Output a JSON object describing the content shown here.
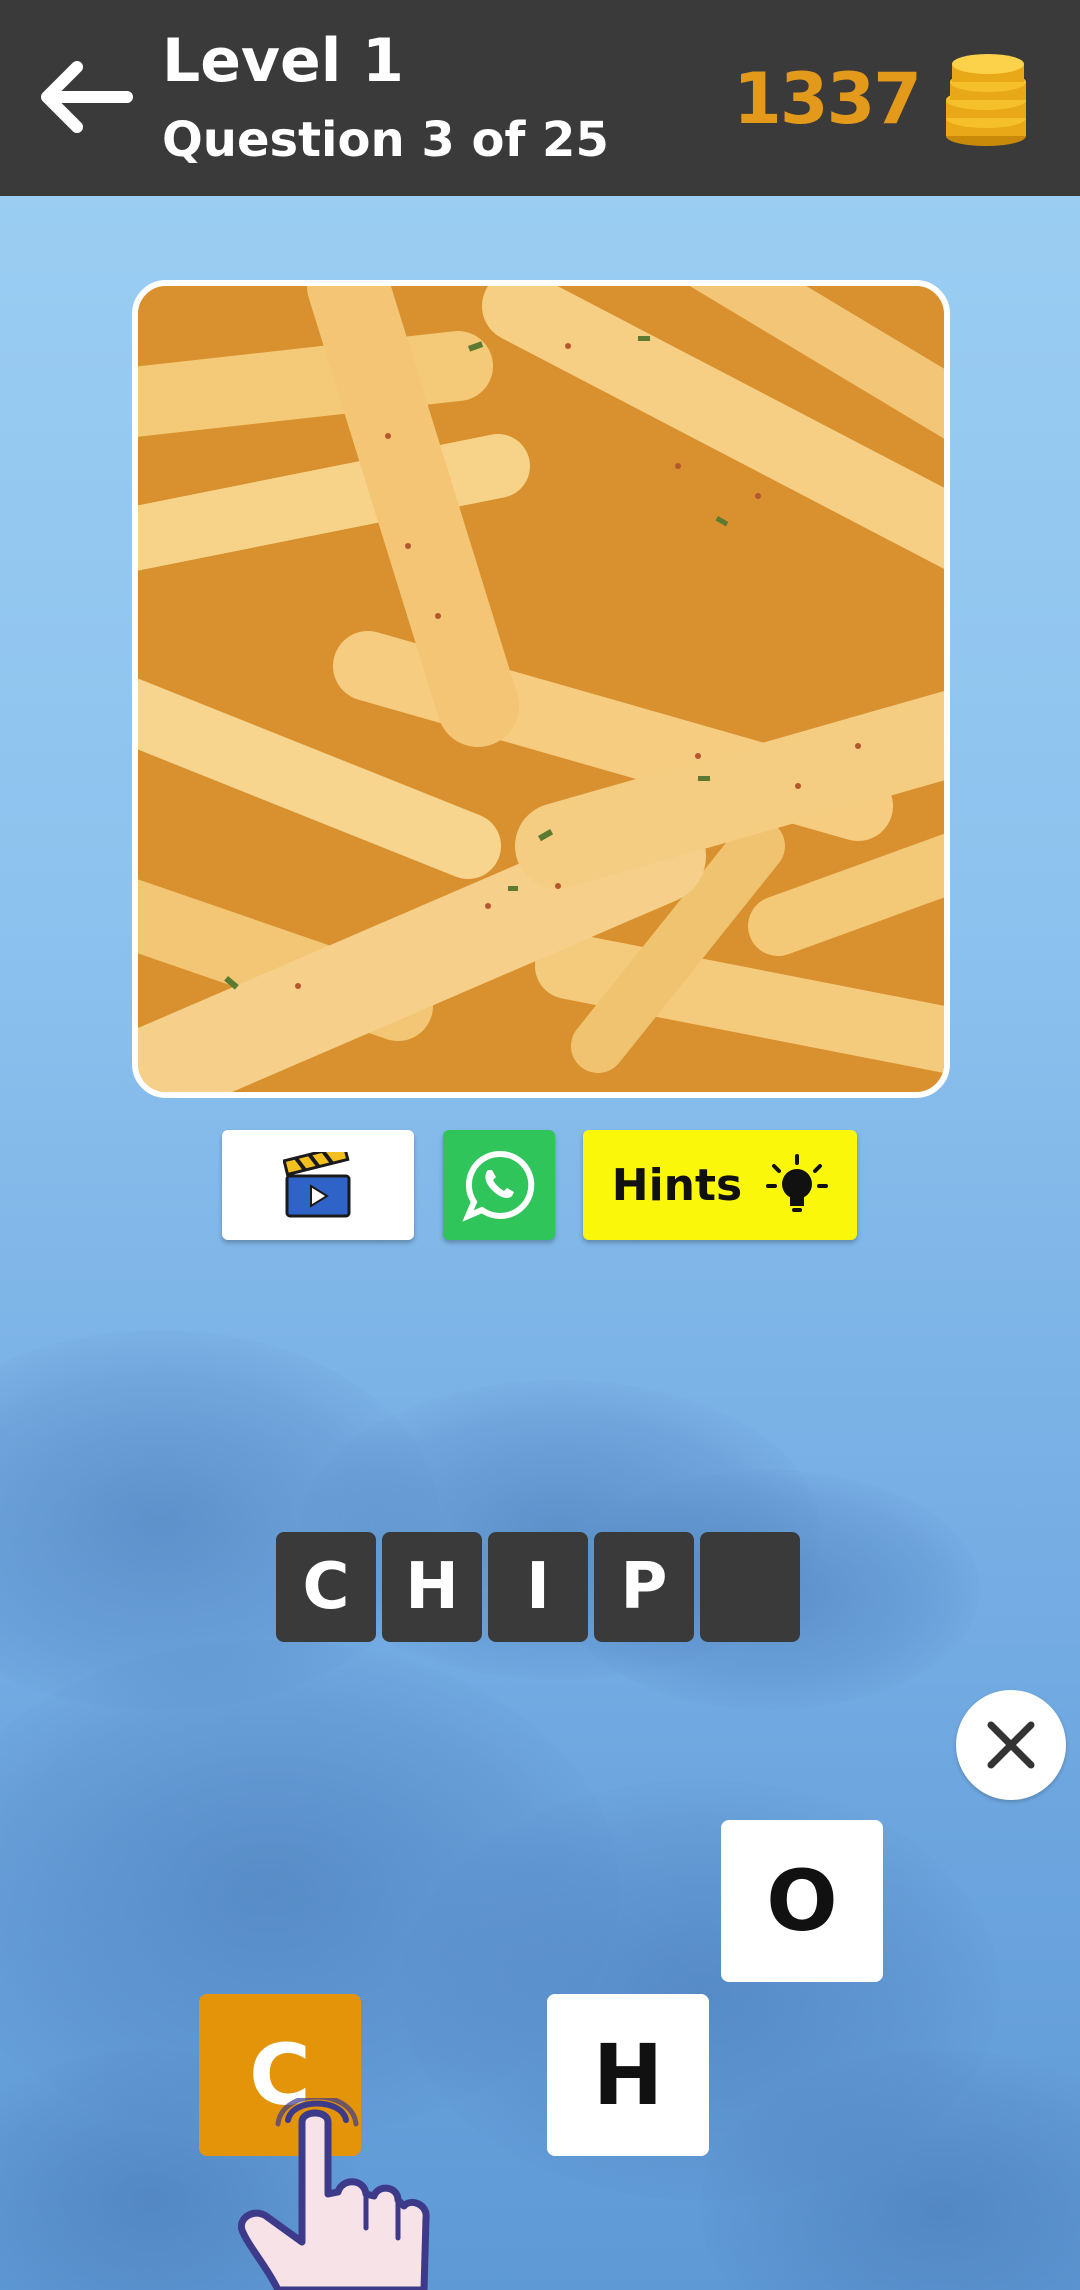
{
  "header": {
    "level_title": "Level 1",
    "question_progress": "Question 3 of 25",
    "coins": "1337",
    "back_icon": "arrow-left-icon",
    "coin_icon": "coin-stack-icon"
  },
  "puzzle": {
    "image": "french-fries-photo",
    "answer_slots": [
      "C",
      "H",
      "I",
      "P",
      ""
    ],
    "letter_tiles": [
      "O",
      "H",
      "C"
    ]
  },
  "actions": {
    "video_icon": "clapperboard-video-icon",
    "whatsapp_icon": "whatsapp-icon",
    "hints_label": "Hints",
    "hints_icon": "lightbulb-icon"
  },
  "colors": {
    "topbar": "#3a3a3a",
    "coin_gold": "#e39a1a",
    "hints_yellow": "#fbf70a",
    "whatsapp_green": "#2fc55a",
    "slot_dark": "#3a3a3a",
    "tile_selected": "#e39409"
  }
}
